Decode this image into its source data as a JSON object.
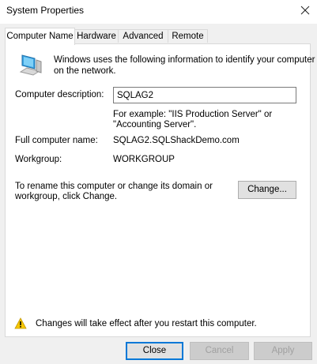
{
  "window": {
    "title": "System Properties"
  },
  "tabs": [
    {
      "label": "Computer Name"
    },
    {
      "label": "Hardware"
    },
    {
      "label": "Advanced"
    },
    {
      "label": "Remote"
    }
  ],
  "panel": {
    "intro_line1": "Windows uses the following information to identify your computer",
    "intro_line2": "on the network.",
    "description_label": "Computer description:",
    "description_value": "SQLAG2",
    "example_line1": "For example: \"IIS Production Server\" or",
    "example_line2": "\"Accounting Server\".",
    "full_name_label": "Full computer name:",
    "full_name_value": "SQLAG2.SQLShackDemo.com",
    "workgroup_label": "Workgroup:",
    "workgroup_value": "WORKGROUP",
    "rename_line1": "To rename this computer or change its domain or",
    "rename_line2": "workgroup, click Change.",
    "change_button": "Change...",
    "warning_text": "Changes will take effect after you restart this computer."
  },
  "footer": {
    "close_button": "Close",
    "cancel_button": "Cancel",
    "apply_button": "Apply"
  },
  "icons": {
    "computer": "computer-icon",
    "warning": "warning-icon",
    "close": "close-icon"
  }
}
